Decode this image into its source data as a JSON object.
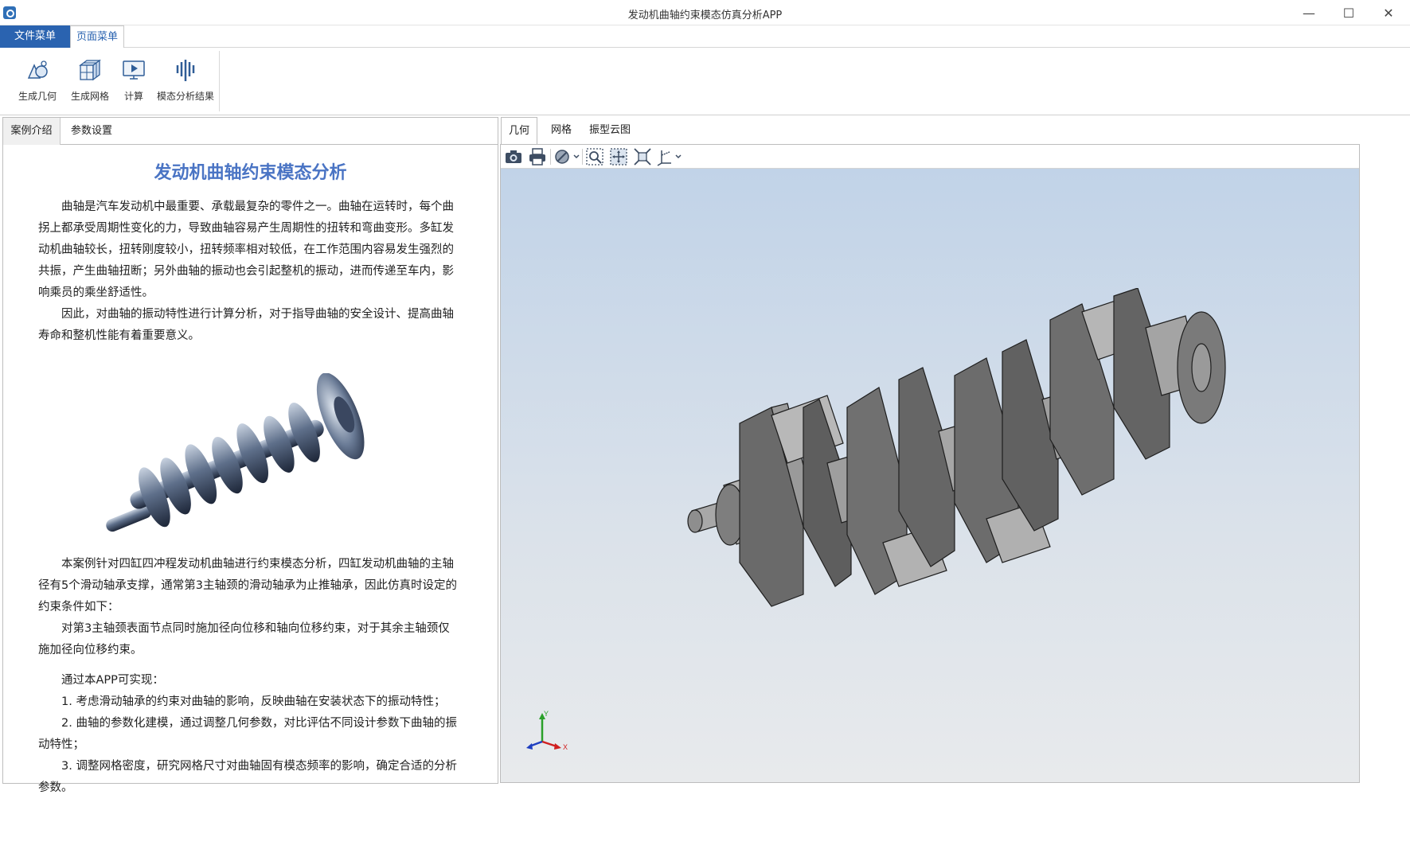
{
  "window": {
    "title": "发动机曲轴约束模态仿真分析APP"
  },
  "menu": {
    "file": "文件菜单",
    "page": "页面菜单"
  },
  "ribbon": {
    "buttons": [
      {
        "label": "生成几何",
        "icon": "geometry-icon"
      },
      {
        "label": "生成网格",
        "icon": "mesh-icon"
      },
      {
        "label": "计算",
        "icon": "compute-icon"
      },
      {
        "label": "模态分析结果",
        "icon": "modal-results-icon"
      }
    ]
  },
  "left_panel": {
    "tabs": [
      "案例介绍",
      "参数设置"
    ],
    "active_tab": "案例介绍",
    "doc": {
      "title": "发动机曲轴约束模态分析",
      "p1": "曲轴是汽车发动机中最重要、承载最复杂的零件之一。曲轴在运转时，每个曲拐上都承受周期性变化的力，导致曲轴容易产生周期性的扭转和弯曲变形。多缸发动机曲轴较长，扭转刚度较小，扭转频率相对较低，在工作范围内容易发生强烈的共振，产生曲轴扭断；另外曲轴的振动也会引起整机的振动，进而传递至车内，影响乘员的乘坐舒适性。",
      "p2": "因此，对曲轴的振动特性进行计算分析，对于指导曲轴的安全设计、提高曲轴寿命和整机性能有着重要意义。",
      "p3": "本案例针对四缸四冲程发动机曲轴进行约束模态分析，四缸发动机曲轴的主轴径有5个滑动轴承支撑，通常第3主轴颈的滑动轴承为止推轴承，因此仿真时设定的约束条件如下：",
      "p4": "对第3主轴颈表面节点同时施加径向位移和轴向位移约束，对于其余主轴颈仅施加径向位移约束。",
      "p5": "通过本APP可实现：",
      "p6": "1. 考虑滑动轴承的约束对曲轴的影响，反映曲轴在安装状态下的振动特性；",
      "p7": "2. 曲轴的参数化建模，通过调整几何参数，对比评估不同设计参数下曲轴的振动特性；",
      "p8": "3. 调整网格密度，研究网格尺寸对曲轴固有模态频率的影响，确定合适的分析参数。"
    }
  },
  "right_panel": {
    "tabs": [
      "几何",
      "网格",
      "振型云图"
    ],
    "active_tab": "几何",
    "toolbar": [
      "camera-icon",
      "print-icon",
      "render-mode-icon",
      "zoom-box-icon",
      "zoom-fit-icon",
      "fit-all-icon",
      "axis-view-icon"
    ],
    "triad": {
      "x": "X",
      "y": "Y"
    }
  },
  "colors": {
    "accent": "#2a63b0",
    "doc_title": "#4a74c4",
    "viewport_top": "#c1d3e8",
    "viewport_bottom": "#e8eaec",
    "model": "#8c8c8c"
  }
}
